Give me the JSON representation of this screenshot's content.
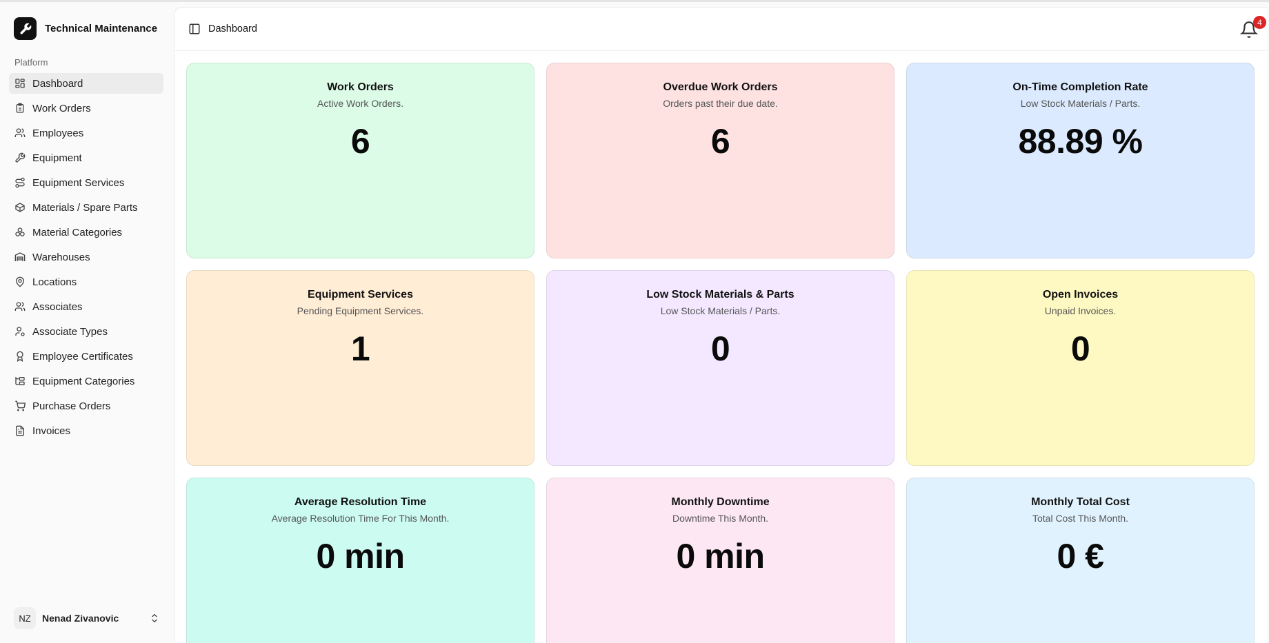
{
  "app": {
    "title": "Technical Maintenance",
    "group_label": "Platform"
  },
  "sidebar": {
    "items": [
      {
        "label": "Dashboard",
        "icon": "dashboard-icon",
        "active": true
      },
      {
        "label": "Work Orders",
        "icon": "clipboard-icon"
      },
      {
        "label": "Employees",
        "icon": "users-icon"
      },
      {
        "label": "Equipment",
        "icon": "wrench-icon"
      },
      {
        "label": "Equipment Services",
        "icon": "route-icon"
      },
      {
        "label": "Materials / Spare Parts",
        "icon": "package-icon"
      },
      {
        "label": "Material Categories",
        "icon": "boxes-icon"
      },
      {
        "label": "Warehouses",
        "icon": "warehouse-icon"
      },
      {
        "label": "Locations",
        "icon": "map-pin-icon"
      },
      {
        "label": "Associates",
        "icon": "users-icon"
      },
      {
        "label": "Associate Types",
        "icon": "user-cog-icon"
      },
      {
        "label": "Employee Certificates",
        "icon": "award-icon"
      },
      {
        "label": "Equipment Categories",
        "icon": "folder-tree-icon"
      },
      {
        "label": "Purchase Orders",
        "icon": "cart-icon"
      },
      {
        "label": "Invoices",
        "icon": "file-text-icon"
      }
    ]
  },
  "user": {
    "initials": "NZ",
    "name": "Nenad Zivanovic"
  },
  "header": {
    "breadcrumb": "Dashboard",
    "notification_count": "4"
  },
  "cards": [
    {
      "title": "Work Orders",
      "subtitle": "Active Work Orders.",
      "value": "6",
      "color": "#dcfce7"
    },
    {
      "title": "Overdue Work Orders",
      "subtitle": "Orders past their due date.",
      "value": "6",
      "color": "#fee2e2"
    },
    {
      "title": "On-Time Completion Rate",
      "subtitle": "Low Stock Materials / Parts.",
      "value": "88.89 %",
      "color": "#dbeafe"
    },
    {
      "title": "Equipment Services",
      "subtitle": "Pending Equipment Services.",
      "value": "1",
      "color": "#ffedd5"
    },
    {
      "title": "Low Stock Materials & Parts",
      "subtitle": "Low Stock Materials / Parts.",
      "value": "0",
      "color": "#f3e8ff"
    },
    {
      "title": "Open Invoices",
      "subtitle": "Unpaid Invoices.",
      "value": "0",
      "color": "#fef9c3"
    },
    {
      "title": "Average Resolution Time",
      "subtitle": "Average Resolution Time For This Month.",
      "value": "0 min",
      "color": "#ccfbf1"
    },
    {
      "title": "Monthly Downtime",
      "subtitle": "Downtime This Month.",
      "value": "0 min",
      "color": "#fce7f3"
    },
    {
      "title": "Monthly Total Cost",
      "subtitle": "Total Cost This Month.",
      "value": "0 €",
      "color": "#e0f2fe"
    }
  ]
}
